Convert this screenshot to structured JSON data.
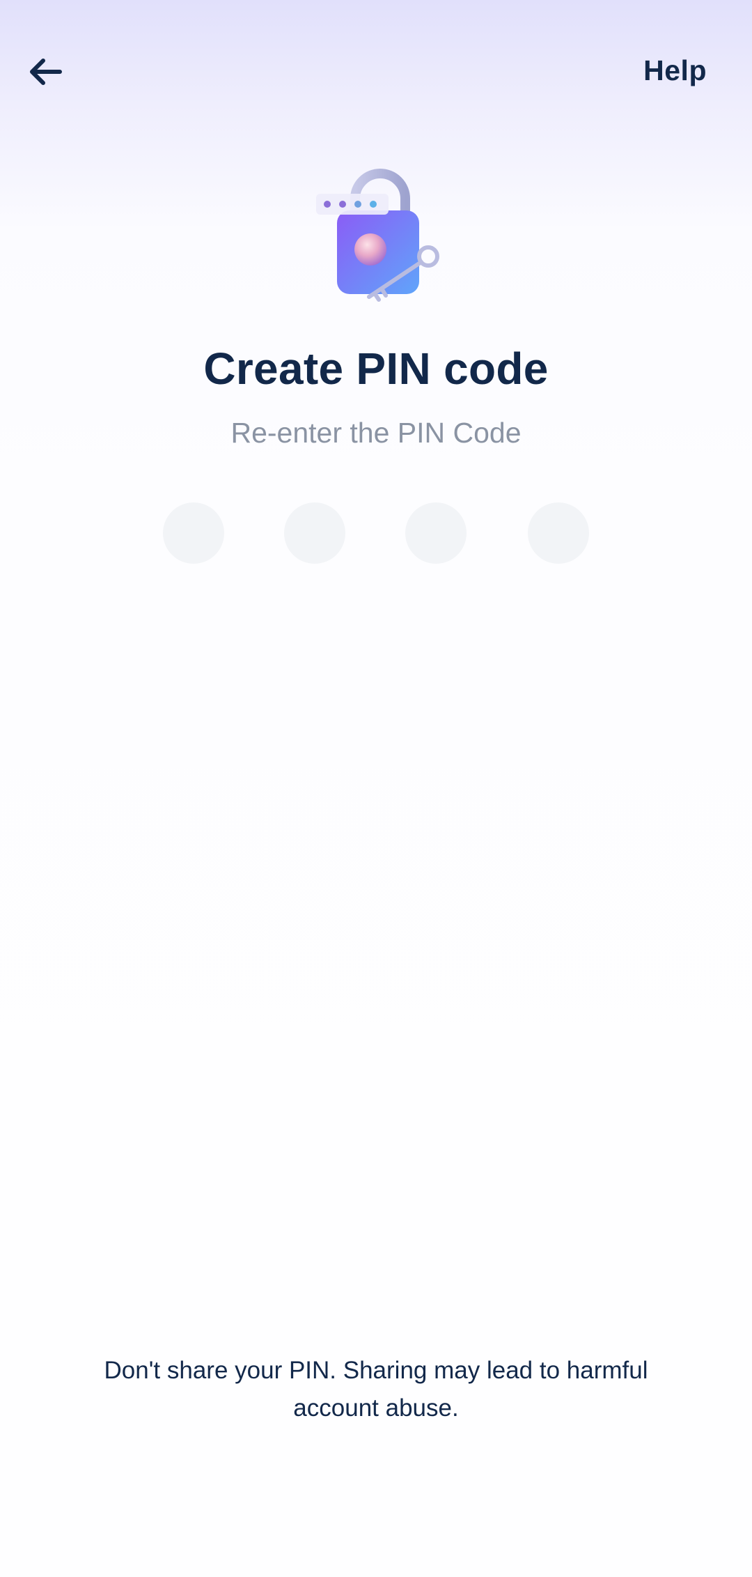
{
  "header": {
    "back_icon": "arrow-left-icon",
    "help_label": "Help"
  },
  "illustration": {
    "icon": "padlock-with-key-icon"
  },
  "main": {
    "title": "Create PIN code",
    "subtitle": "Re-enter the PIN Code"
  },
  "pin": {
    "length": 4,
    "filled": 0
  },
  "footer": {
    "warning_text": "Don't share your PIN. Sharing may lead to harmful account abuse."
  },
  "colors": {
    "text_primary": "#12284a",
    "text_secondary": "#8a93a3",
    "pin_dot": "#f2f4f7",
    "lock_gradient_start": "#8b5cf6",
    "lock_gradient_end": "#60a5fa"
  }
}
